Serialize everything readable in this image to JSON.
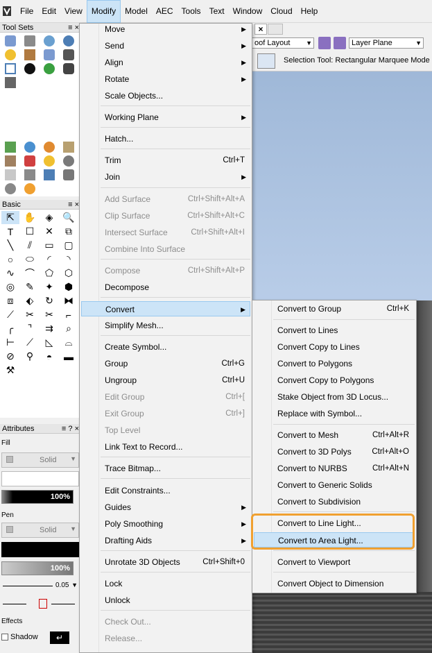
{
  "menubar": {
    "items": [
      "File",
      "Edit",
      "View",
      "Modify",
      "Model",
      "AEC",
      "Tools",
      "Text",
      "Window",
      "Cloud",
      "Help"
    ],
    "active": "Modify"
  },
  "tool_sets": {
    "title": "Tool Sets"
  },
  "basic": {
    "title": "Basic"
  },
  "attributes": {
    "title": "Attributes",
    "fill_label": "Fill",
    "fill_style": "Solid",
    "fill_opacity": "100%",
    "pen_label": "Pen",
    "pen_style": "Solid",
    "pen_opacity": "100%",
    "line_thickness": "0.05",
    "effects_label": "Effects",
    "shadow_label": "Shadow"
  },
  "viewport": {
    "tab_close": "×",
    "layer_combo": "oof Layout",
    "plane_combo": "Layer Plane",
    "mode_text": "Selection Tool: Rectangular Marquee Mode"
  },
  "modify_menu": [
    {
      "label": "Move",
      "submenu": true
    },
    {
      "label": "Send",
      "submenu": true
    },
    {
      "label": "Align",
      "submenu": true
    },
    {
      "label": "Rotate",
      "submenu": true
    },
    {
      "label": "Scale Objects..."
    },
    {
      "label": "Working Plane",
      "submenu": true
    },
    {
      "label": "Hatch..."
    },
    {
      "label": "Trim",
      "shortcut": "Ctrl+T"
    },
    {
      "label": "Join",
      "submenu": true
    },
    {
      "label": "Add Surface",
      "shortcut": "Ctrl+Shift+Alt+A",
      "disabled": true
    },
    {
      "label": "Clip Surface",
      "shortcut": "Ctrl+Shift+Alt+C",
      "disabled": true
    },
    {
      "label": "Intersect Surface",
      "shortcut": "Ctrl+Shift+Alt+I",
      "disabled": true
    },
    {
      "label": "Combine Into Surface",
      "disabled": true
    },
    {
      "label": "Compose",
      "shortcut": "Ctrl+Shift+Alt+P",
      "disabled": true
    },
    {
      "label": "Decompose"
    },
    {
      "label": "Convert",
      "submenu": true,
      "highlighted": true
    },
    {
      "label": "Simplify Mesh..."
    },
    {
      "label": "Create Symbol..."
    },
    {
      "label": "Group",
      "shortcut": "Ctrl+G"
    },
    {
      "label": "Ungroup",
      "shortcut": "Ctrl+U"
    },
    {
      "label": "Edit Group",
      "shortcut": "Ctrl+[",
      "disabled": true
    },
    {
      "label": "Exit Group",
      "shortcut": "Ctrl+]",
      "disabled": true
    },
    {
      "label": "Top Level",
      "disabled": true
    },
    {
      "label": "Link Text to Record..."
    },
    {
      "label": "Trace Bitmap..."
    },
    {
      "label": "Edit Constraints..."
    },
    {
      "label": "Guides",
      "submenu": true
    },
    {
      "label": "Poly Smoothing",
      "submenu": true
    },
    {
      "label": "Drafting Aids",
      "submenu": true
    },
    {
      "label": "Unrotate 3D Objects",
      "shortcut": "Ctrl+Shift+0"
    },
    {
      "label": "Lock"
    },
    {
      "label": "Unlock"
    },
    {
      "label": "Check Out...",
      "disabled": true
    },
    {
      "label": "Release...",
      "disabled": true
    }
  ],
  "convert_menu": [
    {
      "label": "Convert to Group",
      "shortcut": "Ctrl+K"
    },
    {
      "label": "Convert to Lines"
    },
    {
      "label": "Convert Copy to Lines"
    },
    {
      "label": "Convert to Polygons"
    },
    {
      "label": "Convert Copy to Polygons"
    },
    {
      "label": "Stake Object from 3D Locus..."
    },
    {
      "label": "Replace with Symbol..."
    },
    {
      "label": "Convert to Mesh",
      "shortcut": "Ctrl+Alt+R"
    },
    {
      "label": "Convert to 3D Polys",
      "shortcut": "Ctrl+Alt+O"
    },
    {
      "label": "Convert to NURBS",
      "shortcut": "Ctrl+Alt+N"
    },
    {
      "label": "Convert to Generic Solids"
    },
    {
      "label": "Convert to Subdivision"
    },
    {
      "label": "Convert to Line Light..."
    },
    {
      "label": "Convert to Area Light...",
      "highlighted": true
    },
    {
      "label": "Convert to Viewport"
    },
    {
      "label": "Convert Object to Dimension"
    }
  ]
}
